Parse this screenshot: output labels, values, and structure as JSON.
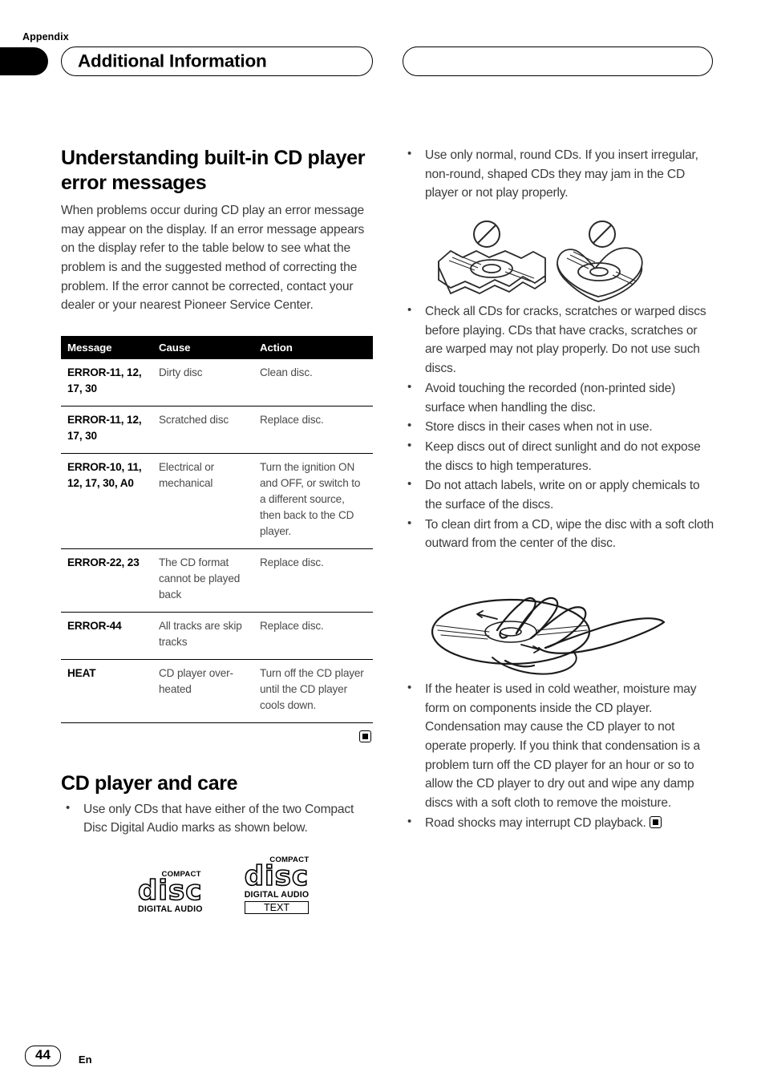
{
  "header": {
    "appendix_label": "Appendix",
    "title": "Additional Information",
    "right_pill_text": ""
  },
  "left_column": {
    "heading": "Understanding built-in CD player error messages",
    "intro": "When problems occur during CD play an error message may appear on the display. If an error message appears on the display refer to the table below to see what the problem is and the suggested method of correcting the problem. If the error cannot be corrected, contact your dealer or your nearest Pioneer Service Center.",
    "table": {
      "columns": [
        "Message",
        "Cause",
        "Action"
      ],
      "rows": [
        {
          "message": "ERROR-11, 12, 17, 30",
          "cause": "Dirty disc",
          "action": "Clean disc."
        },
        {
          "message": "ERROR-11, 12, 17, 30",
          "cause": "Scratched disc",
          "action": "Replace disc."
        },
        {
          "message": "ERROR-10, 11, 12, 17, 30, A0",
          "cause": "Electrical or mechanical",
          "action": "Turn the ignition ON and OFF, or switch to a different source, then back to the CD player."
        },
        {
          "message": "ERROR-22, 23",
          "cause": "The CD format cannot be played back",
          "action": "Replace disc."
        },
        {
          "message": "ERROR-44",
          "cause": "All tracks are skip tracks",
          "action": "Replace disc."
        },
        {
          "message": "HEAT",
          "cause": "CD player over-heated",
          "action": "Turn off the CD player until the CD player cools down."
        }
      ]
    },
    "heading2": "CD player and care",
    "bullets": [
      "Use only CDs that have either of the two Compact Disc Digital Audio marks as shown below."
    ],
    "logos": [
      {
        "compact": "COMPACT",
        "disc": "disc",
        "digital_audio": "DIGITAL AUDIO",
        "text_badge": ""
      },
      {
        "compact": "COMPACT",
        "disc": "disc",
        "digital_audio": "DIGITAL AUDIO",
        "text_badge": "TEXT"
      }
    ]
  },
  "right_column": {
    "bullets_top": [
      "Use only normal, round CDs. If you insert irregular, non-round, shaped CDs they may jam in the CD player or not play properly."
    ],
    "illustration_shapes_alt": "Prohibition symbols above a notched-square shaped CD and a heart shaped CD",
    "bullets_mid": [
      "Check all CDs for cracks, scratches or warped discs before playing. CDs that have cracks, scratches or are warped may not play properly. Do not use such discs.",
      "Avoid touching the recorded (non-printed side) surface when handling the disc.",
      "Store discs in their cases when not in use.",
      "Keep discs out of direct sunlight and do not expose the discs to high temperatures.",
      "Do not attach labels, write on or apply chemicals to the surface of the discs.",
      "To clean dirt from a CD, wipe the disc with a soft cloth outward from the center of the disc."
    ],
    "illustration_wipe_alt": "A hand wiping a CD with a cloth outward from the center",
    "bullets_bottom": [
      "If the heater is used in cold weather, moisture may form on components inside the CD player. Condensation may cause the CD player to not operate properly. If you think that condensation is a problem turn off the CD player for an hour or so to allow the CD player to dry out and wipe any damp discs with a soft cloth to remove the moisture.",
      "Road shocks may interrupt CD playback."
    ]
  },
  "footer": {
    "page_number": "44",
    "language": "En"
  },
  "colors": {
    "ink": "#000000",
    "body_text": "#3b3b3b",
    "table_header_bg": "#000000",
    "table_header_text": "#ffffff"
  }
}
